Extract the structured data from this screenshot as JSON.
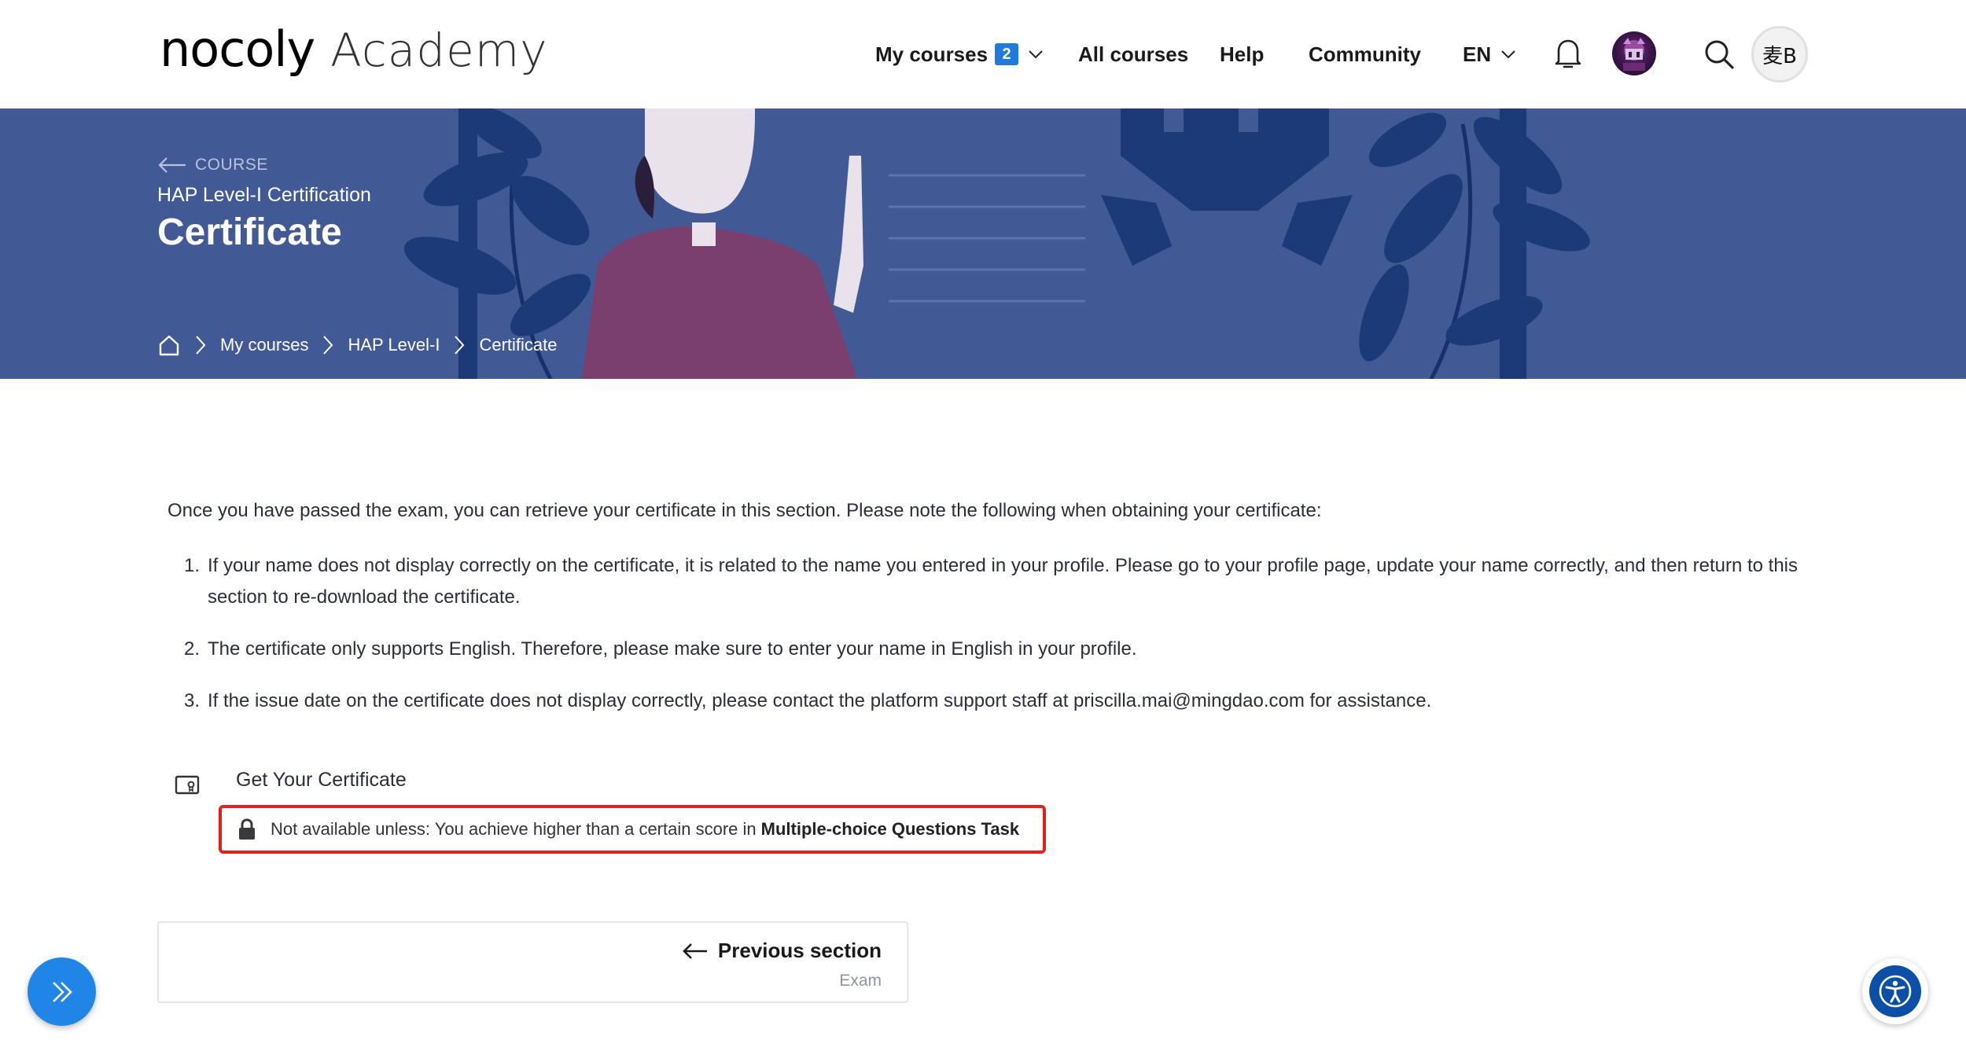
{
  "header": {
    "logo_brand": "nocoly",
    "logo_sub": "Academy",
    "nav": {
      "my_courses": "My courses",
      "my_courses_count": "2",
      "all_courses": "All courses",
      "help": "Help",
      "community": "Community",
      "language": "EN"
    },
    "user_initials": "麦B"
  },
  "banner": {
    "back_label": "COURSE",
    "course_name": "HAP Level-I Certification",
    "page_title": "Certificate",
    "breadcrumb": [
      "My courses",
      "HAP Level-I",
      "Certificate"
    ]
  },
  "content": {
    "intro": "Once you have passed the exam, you can retrieve your certificate in this section. Please note the following when obtaining your certificate:",
    "rules": [
      {
        "num": "1.",
        "text": "If your name does not display correctly on the certificate, it is related to the name you entered in your profile. Please go to your profile page, update your name correctly, and then return to this section to re-download the certificate."
      },
      {
        "num": "2.",
        "text": "The certificate only supports English. Therefore, please make sure to enter your name in English in your profile."
      },
      {
        "num": "3.",
        "text": "If the issue date on the certificate does not display correctly, please contact the platform support staff at priscilla.mai@mingdao.com for assistance."
      }
    ],
    "activity": {
      "title": "Get Your Certificate",
      "restriction_text": "Not available unless: You achieve higher than a certain score in",
      "restriction_target": "Multiple-choice Questions Task"
    },
    "prev_section": {
      "label": "Previous section",
      "name": "Exam"
    }
  },
  "colors": {
    "banner_bg": "#415994",
    "badge_blue": "#1f7ae0",
    "restriction_border": "#e3201b",
    "drawer_button": "#1f86e8",
    "a11y_button": "#0b4fa8"
  }
}
